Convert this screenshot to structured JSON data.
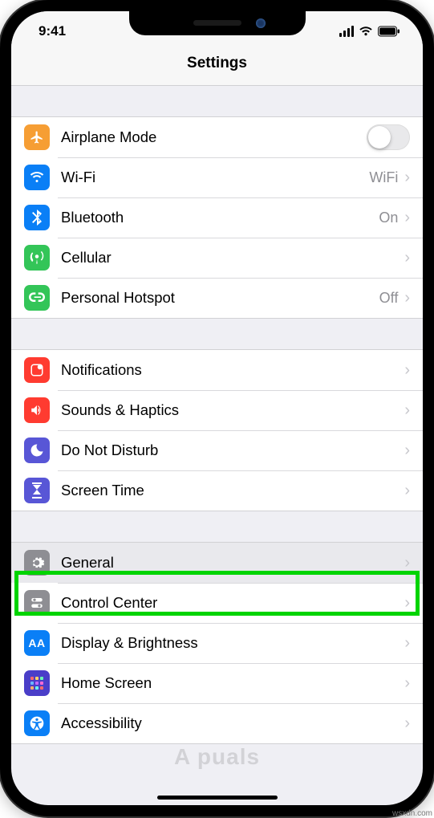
{
  "status": {
    "time": "9:41"
  },
  "header": {
    "title": "Settings"
  },
  "group1": {
    "airplane": {
      "label": "Airplane Mode"
    },
    "wifi": {
      "label": "Wi-Fi",
      "value": "WiFi"
    },
    "bluetooth": {
      "label": "Bluetooth",
      "value": "On"
    },
    "cellular": {
      "label": "Cellular"
    },
    "hotspot": {
      "label": "Personal Hotspot",
      "value": "Off"
    }
  },
  "group2": {
    "notifications": {
      "label": "Notifications"
    },
    "sounds": {
      "label": "Sounds & Haptics"
    },
    "dnd": {
      "label": "Do Not Disturb"
    },
    "screentime": {
      "label": "Screen Time"
    }
  },
  "group3": {
    "general": {
      "label": "General"
    },
    "control": {
      "label": "Control Center"
    },
    "display": {
      "label": "Display & Brightness"
    },
    "home": {
      "label": "Home Screen"
    },
    "accessibility": {
      "label": "Accessibility"
    }
  },
  "watermark": "A  puals",
  "credit": "wsxdn.com"
}
